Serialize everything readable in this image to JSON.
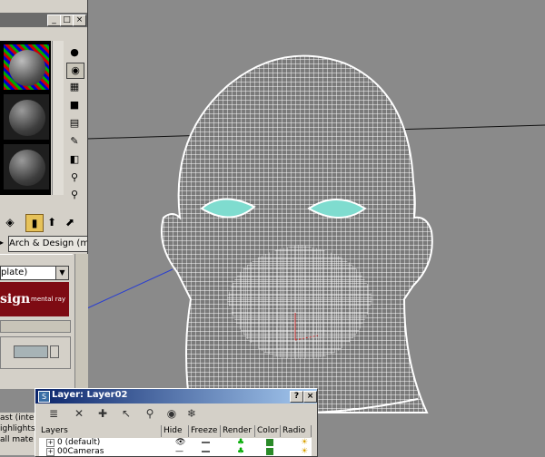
{
  "material_editor": {
    "window_buttons": [
      "_",
      "□",
      "×"
    ],
    "renderer_dropdown": "Arch & Design (mi)",
    "template_dropdown": "plate)",
    "banner_title": "sign",
    "banner_subtitle": "mental ray"
  },
  "layer_dialog": {
    "title": "Layer: Layer02",
    "title_buttons": [
      "?",
      "×"
    ],
    "columns": [
      "Layers",
      "Hide",
      "Freeze",
      "Render",
      "Color",
      "Radio"
    ],
    "rows": [
      {
        "name": "0 (default)"
      },
      {
        "name": "00Cameras"
      }
    ]
  },
  "cut_off_list": [
    "ast (interp",
    "ighlights+",
    "all mate"
  ],
  "colors": {
    "viewport_bg": "#8a8a8a",
    "panel_bg": "#d4d0c8",
    "eye_color": "#7fdccf",
    "banner_color": "#7e0b13",
    "layer_color": "#2a8a28"
  }
}
